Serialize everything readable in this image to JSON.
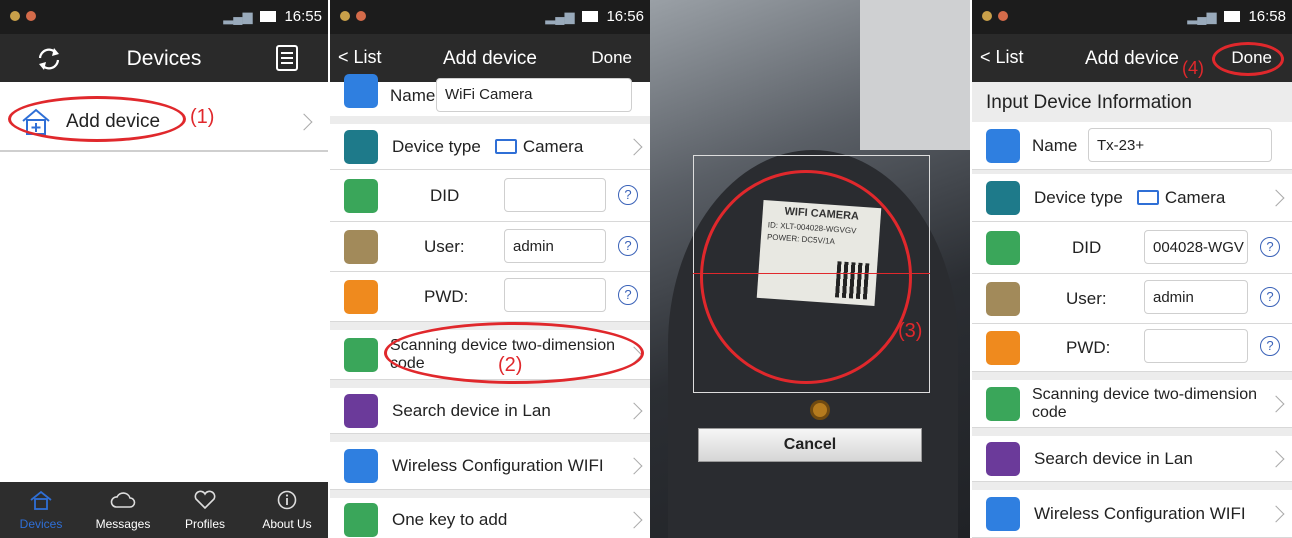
{
  "p1": {
    "time": "16:55",
    "title": "Devices",
    "add_label": "Add device",
    "note": "(1)",
    "tabs": [
      {
        "label": "Devices"
      },
      {
        "label": "Messages"
      },
      {
        "label": "Profiles"
      },
      {
        "label": "About Us"
      }
    ]
  },
  "p2": {
    "time": "16:56",
    "back": "List",
    "title": "Add device",
    "done": "Done",
    "name_label": "Name",
    "name_value": "WiFi Camera",
    "type_label": "Device type",
    "type_value": "Camera",
    "did_label": "DID",
    "did_value": "",
    "user_label": "User:",
    "user_value": "admin",
    "pwd_label": "PWD:",
    "pwd_value": "",
    "scan_line1": "Scanning device two-dimension",
    "scan_line2": "code",
    "note": "(2)",
    "search": "Search device in Lan",
    "wifi": "Wireless Configuration WIFI",
    "onekey": "One key to add"
  },
  "p3": {
    "note": "(3)",
    "cancel": "Cancel",
    "label_lines": [
      "WIFI CAMERA",
      "ID: XLT-004028-WGVGV",
      "POWER: DC5V/1A"
    ]
  },
  "p4": {
    "time": "16:58",
    "back": "List",
    "title": "Add device",
    "done": "Done",
    "note": "(4)",
    "section": "Input Device Information",
    "name_label": "Name",
    "name_value": "Tx-23+",
    "type_label": "Device type",
    "type_value": "Camera",
    "did_label": "DID",
    "did_value": "004028-WGV",
    "user_label": "User:",
    "user_value": "admin",
    "pwd_label": "PWD:",
    "pwd_value": "",
    "scan_line1": "Scanning device two-dimension",
    "scan_line2": "code",
    "search": "Search device in Lan",
    "wifi": "Wireless Configuration WIFI"
  },
  "colors": {
    "accent": "#2f6fd6",
    "annotation": "#e0282c",
    "navbar": "#2a2a2a"
  }
}
